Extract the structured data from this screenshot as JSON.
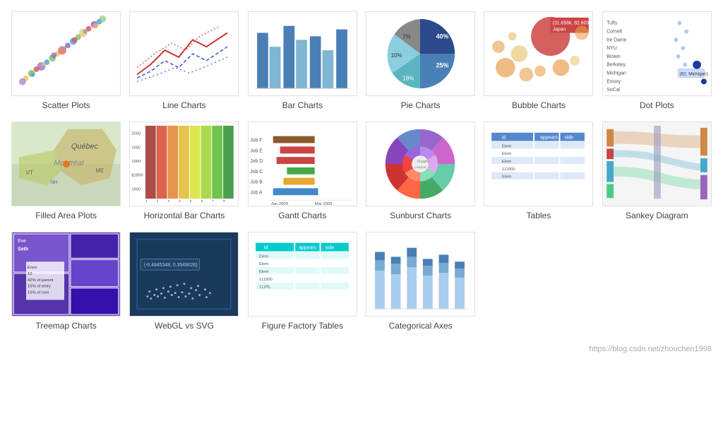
{
  "charts": [
    {
      "id": "scatter",
      "label": "Scatter Plots"
    },
    {
      "id": "line",
      "label": "Line Charts"
    },
    {
      "id": "bar",
      "label": "Bar Charts"
    },
    {
      "id": "pie",
      "label": "Pie Charts"
    },
    {
      "id": "bubble",
      "label": "Bubble Charts"
    },
    {
      "id": "dotplot",
      "label": "Dot Plots"
    },
    {
      "id": "filledarea",
      "label": "Filled Area Plots"
    },
    {
      "id": "horizbar",
      "label": "Horizontal Bar Charts"
    },
    {
      "id": "gantt",
      "label": "Gantt Charts"
    },
    {
      "id": "sunburst",
      "label": "Sunburst Charts"
    },
    {
      "id": "tables",
      "label": "Tables"
    },
    {
      "id": "sankey",
      "label": "Sankey Diagram"
    },
    {
      "id": "treemap",
      "label": "Treemap Charts"
    },
    {
      "id": "webgl",
      "label": "WebGL vs SVG"
    },
    {
      "id": "figfact",
      "label": "Figure Factory Tables"
    },
    {
      "id": "catax",
      "label": "Categorical Axes"
    }
  ],
  "footer": {
    "link": "https://blog.csdn.net/zhouchen1998"
  }
}
